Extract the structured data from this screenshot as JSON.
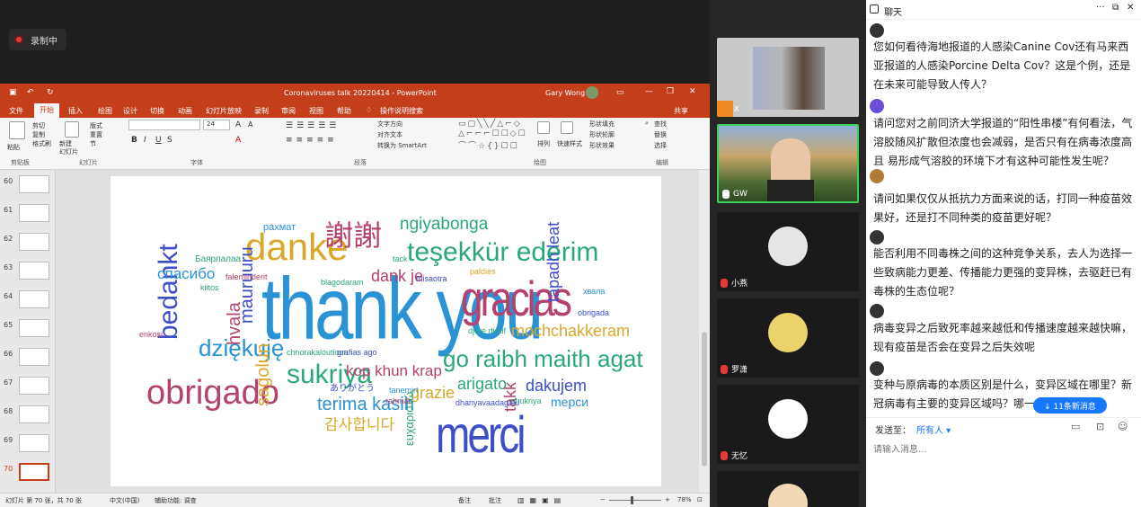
{
  "recording": {
    "label": "录制中"
  },
  "ppt": {
    "doc_title": "Coronaviruses talk 20220414  -  PowerPoint",
    "user": "Gary Wong",
    "tabs": [
      "文件",
      "开始",
      "插入",
      "绘图",
      "设计",
      "切换",
      "动画",
      "幻灯片放映",
      "录制",
      "审阅",
      "视图",
      "帮助"
    ],
    "tell_me": "操作说明搜索",
    "share": "共享",
    "ribbon": {
      "paste": "粘贴",
      "cut": "剪切",
      "copy": "复制",
      "format_painter": "格式刷",
      "clipboard": "剪贴板",
      "new_slide": "新建\n幻灯片",
      "layout": "版式",
      "reset": "重置",
      "section": "节",
      "slides": "幻灯片",
      "font": "字体",
      "paragraph": "段落",
      "text_direction": "文字方向",
      "align_text": "对齐文本",
      "smartart": "转换为 SmartArt",
      "drawing": "绘图",
      "arrange": "排列",
      "quick_styles": "快速样式",
      "shape_fill": "形状填充",
      "shape_outline": "形状轮廓",
      "shape_effects": "形状效果",
      "find": "查找",
      "replace": "替换",
      "select": "选择",
      "editing": "编辑",
      "font_size": "24"
    },
    "thumbs": [
      "60",
      "61",
      "62",
      "63",
      "64",
      "65",
      "66",
      "67",
      "68",
      "69",
      "70"
    ],
    "status": {
      "slide_of": "幻灯片 第 70 张，共 70 张",
      "language": "中文(中国)",
      "accessibility": "辅助功能: 调查",
      "notes": "备注",
      "comments": "批注",
      "zoom": "78%"
    }
  },
  "wordcloud": [
    {
      "t": "thank you",
      "c": "#2a93d5"
    },
    {
      "t": "danke",
      "c": "#d9a82b"
    },
    {
      "t": "謝謝",
      "c": "#b5426e"
    },
    {
      "t": "gracias",
      "c": "#b5426e"
    },
    {
      "t": "merci",
      "c": "#3d4ec8"
    },
    {
      "t": "obrigado",
      "c": "#b5426e"
    },
    {
      "t": "teşekkür ederim",
      "c": "#2aa87a"
    },
    {
      "t": "ngiyabonga",
      "c": "#2aa87a"
    },
    {
      "t": "dziękuję",
      "c": "#2a93d5"
    },
    {
      "t": "bedankt",
      "c": "#3d4ec8"
    },
    {
      "t": "sukriya",
      "c": "#2aa87a"
    },
    {
      "t": "go raibh maith agat",
      "c": "#2aa87a"
    },
    {
      "t": "mochchakkeram",
      "c": "#d9a82b"
    },
    {
      "t": "kop khun krap",
      "c": "#b5426e"
    },
    {
      "t": "terima kasih",
      "c": "#2a93d5"
    },
    {
      "t": "감사합니다",
      "c": "#d9a82b"
    },
    {
      "t": "спасибо",
      "c": "#2a93d5"
    },
    {
      "t": "dank je",
      "c": "#b5426e"
    },
    {
      "t": "tapadh leat",
      "c": "#3d4ec8"
    },
    {
      "t": "arigato",
      "c": "#2aa87a"
    },
    {
      "t": "dakujem",
      "c": "#3d4ec8"
    },
    {
      "t": "grazie",
      "c": "#d9a82b"
    },
    {
      "t": "takk",
      "c": "#b5426e"
    },
    {
      "t": "mерси",
      "c": "#2a93d5"
    },
    {
      "t": "sagolun",
      "c": "#d9a82b"
    },
    {
      "t": "hvala",
      "c": "#b5426e"
    },
    {
      "t": "mauruuru",
      "c": "#3d4ec8"
    },
    {
      "t": "ευχαριστώ",
      "c": "#2aa87a"
    },
    {
      "t": "рахмат",
      "c": "#2a93d5"
    },
    {
      "t": "Баярлалаа",
      "c": "#2aa87a"
    },
    {
      "t": "ありがとう",
      "c": "#3d4ec8"
    },
    {
      "t": "faleminderit",
      "c": "#b5426e"
    },
    {
      "t": "kiitos",
      "c": "#2aa87a"
    },
    {
      "t": "paldies",
      "c": "#d9a82b"
    },
    {
      "t": "tack",
      "c": "#2aa87a"
    },
    {
      "t": "xвала",
      "c": "#2a93d5"
    },
    {
      "t": "obrigada",
      "c": "#3d4ec8"
    },
    {
      "t": "enkosi",
      "c": "#b5426e"
    },
    {
      "t": "blagodaram",
      "c": "#2aa87a"
    },
    {
      "t": "misaotra",
      "c": "#3d4ec8"
    },
    {
      "t": "chnorakaloutioun",
      "c": "#2aa87a"
    },
    {
      "t": "grafias ago",
      "c": "#3d4ec8"
    },
    {
      "t": "djere dieuf",
      "c": "#2aa87a"
    },
    {
      "t": "tanemirt",
      "c": "#2a93d5"
    },
    {
      "t": "rahmat",
      "c": "#b5426e"
    },
    {
      "t": "shukriya",
      "c": "#2aa87a"
    },
    {
      "t": "dhanyavaadagalu",
      "c": "#3d4ec8"
    }
  ],
  "videos": [
    {
      "name": "JX",
      "mic": "on"
    },
    {
      "name": "GW",
      "mic": "on"
    },
    {
      "name": "小燕",
      "mic": "off"
    },
    {
      "name": "罗潇",
      "mic": "off"
    },
    {
      "name": "无忆",
      "mic": "off"
    }
  ],
  "chat": {
    "title": "聊天",
    "messages": [
      "您如何看待海地报道的人感染Canine Cov还有马来西亚报道的人感染Porcine Delta Cov？这是个例，还是在未来可能导致人传人？",
      "请问您对之前同济大学报道的“阳性串楼”有何看法，气溶胶随风扩散但浓度也会减弱，是否只有在病毒浓度高 且 易形成气溶胶的环境下才有这种可能性发生呢？",
      "请问如果仅仅从抵抗力方面来说的话，打同一种疫苗效果好，还是打不同种类的疫苗更好呢？",
      "能否利用不同毒株之间的这种竞争关系，去人为选择一些致病能力更差、传播能力更强的变异株，去驱赶已有毒株的生态位呢？",
      "病毒变异之后致死率越来越低和传播速度越来越快嘛，现有疫苗是否会在变异之后失效呢",
      "变种与原病毒的本质区别是什么，变异区域在哪里？新冠病毒有主要的变异区域吗？哪一部分的"
    ],
    "new_messages": "↓ 11条新消息",
    "send_to_label": "发送至：",
    "send_target": "所有人 ▾",
    "input_placeholder": "请输入消息..."
  }
}
